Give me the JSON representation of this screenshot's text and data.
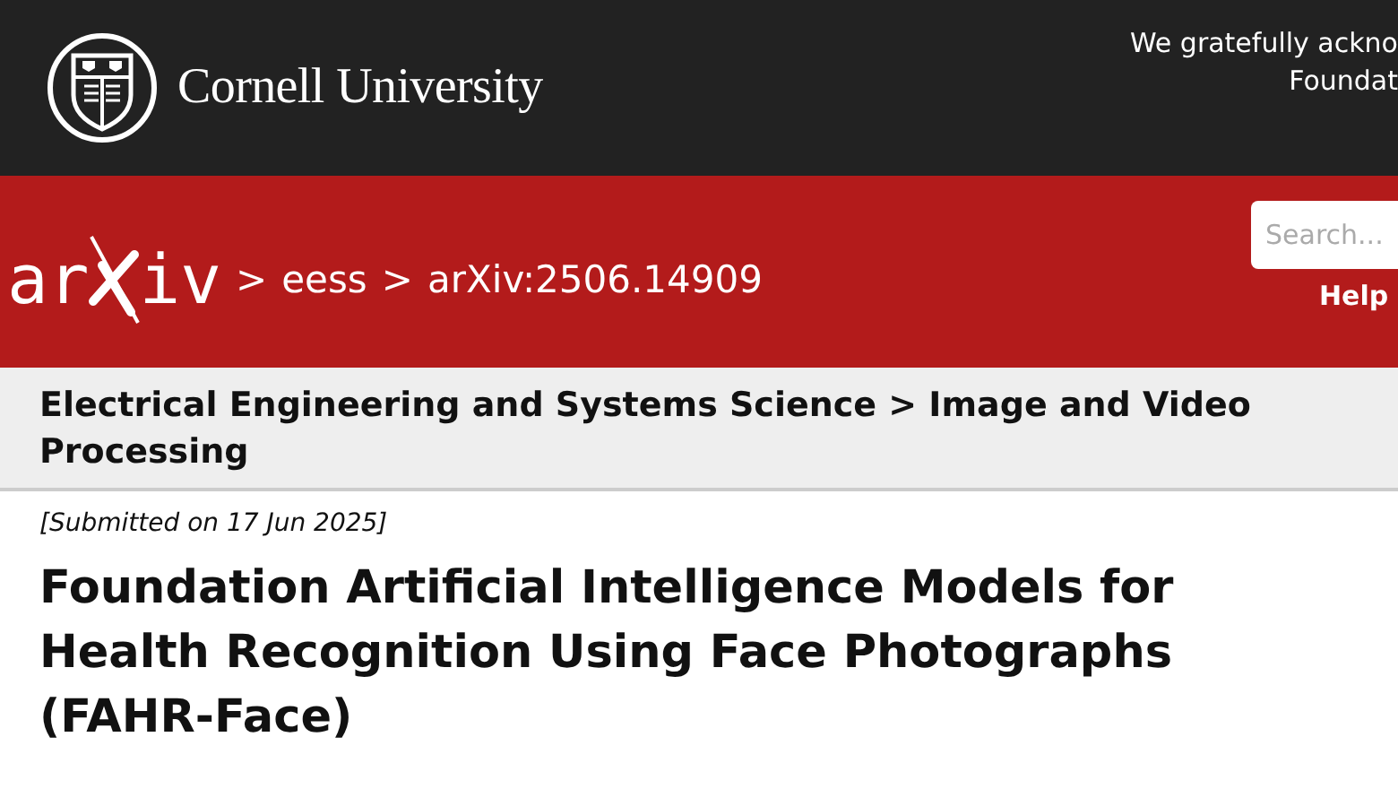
{
  "header": {
    "institution": "Cornell University",
    "acknowledgement": [
      "We gratefully ackno",
      "Foundat"
    ]
  },
  "banner": {
    "logo_left": "ar",
    "logo_right": "iv",
    "breadcrumbs": [
      {
        "separator": ">",
        "label": "eess"
      },
      {
        "separator": ">",
        "label": "arXiv:2506.14909"
      }
    ],
    "search": {
      "placeholder": "Search..."
    },
    "help": "Help"
  },
  "subject": "Electrical Engineering and Systems Science > Image and Video Processing",
  "submitted": "[Submitted on 17 Jun 2025]",
  "title": "Foundation Artificial Intelligence Models for Health Recognition Using Face Photographs (FAHR-Face)"
}
